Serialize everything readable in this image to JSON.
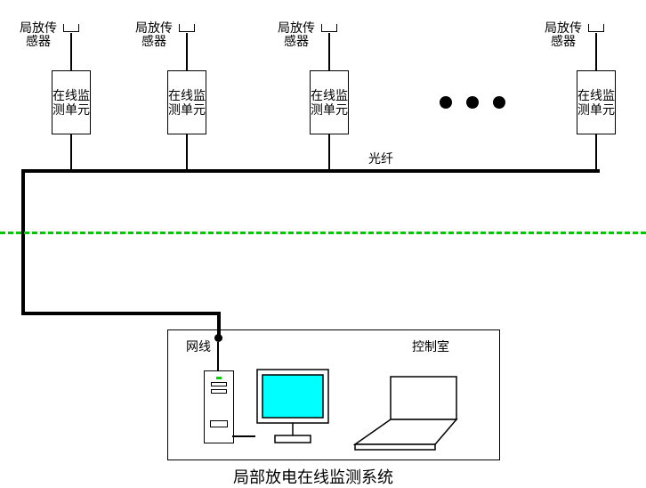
{
  "sensor_label": "局放传感器",
  "unit_label": "在线监测单元",
  "fiber_label": "光纤",
  "lan_label": "网线",
  "control_room_label": "控制室",
  "title": "局部放电在线监测系统"
}
